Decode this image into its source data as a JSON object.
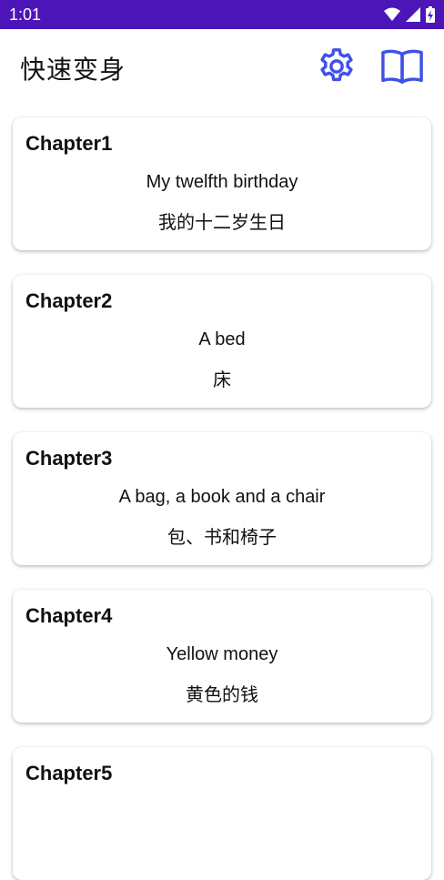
{
  "status_bar": {
    "time": "1:01",
    "icons": [
      "wifi-icon",
      "signal-icon",
      "battery-charging-icon"
    ]
  },
  "app_bar": {
    "title": "快速变身",
    "actions": [
      {
        "icon": "gear-icon",
        "color": "#3F51E6"
      },
      {
        "icon": "book-icon",
        "color": "#3F51E6"
      }
    ]
  },
  "chapters": [
    {
      "title": "Chapter1",
      "english": "My twelfth birthday",
      "chinese": "我的十二岁生日"
    },
    {
      "title": "Chapter2",
      "english": "A bed",
      "chinese": "床"
    },
    {
      "title": "Chapter3",
      "english": "A bag, a book and a chair",
      "chinese": "包、书和椅子"
    },
    {
      "title": "Chapter4",
      "english": "Yellow money",
      "chinese": "黄色的钱"
    },
    {
      "title": "Chapter5",
      "english": "",
      "chinese": ""
    }
  ],
  "colors": {
    "status_bar_bg": "#4B15B8",
    "accent": "#3F51E6"
  }
}
